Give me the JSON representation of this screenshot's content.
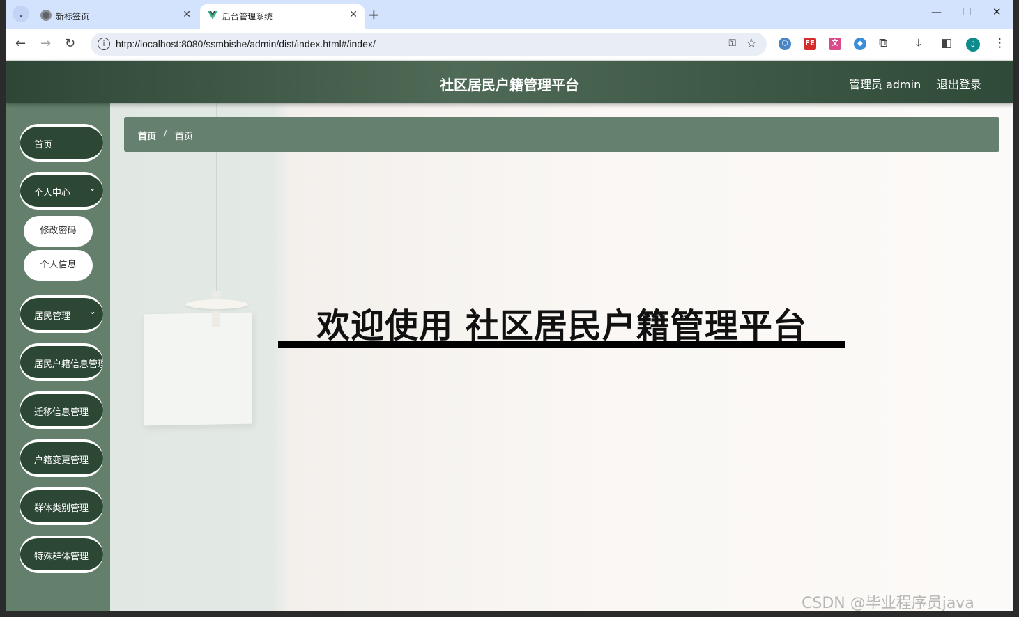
{
  "browser": {
    "tabs": [
      {
        "title": "新标签页",
        "active": false
      },
      {
        "title": "后台管理系统",
        "active": true
      }
    ],
    "url": "http://localhost:8080/ssmbishe/admin/dist/index.html#/index/",
    "profile_initial": "J"
  },
  "header": {
    "title": "社区居民户籍管理平台",
    "user_label": "管理员 admin",
    "logout_label": "退出登录"
  },
  "sidebar": {
    "items": [
      {
        "label": "首页"
      },
      {
        "label": "个人中心",
        "expandable": true,
        "children": [
          {
            "label": "修改密码"
          },
          {
            "label": "个人信息"
          }
        ]
      },
      {
        "label": "居民管理",
        "expandable": true
      },
      {
        "label": "居民户籍信息管理"
      },
      {
        "label": "迁移信息管理"
      },
      {
        "label": "户籍变更管理"
      },
      {
        "label": "群体类别管理"
      },
      {
        "label": "特殊群体管理"
      }
    ]
  },
  "breadcrumb": {
    "items": [
      "首页",
      "首页"
    ],
    "separator": "/"
  },
  "main": {
    "welcome_text": "欢迎使用 社区居民户籍管理平台"
  },
  "watermark": "CSDN @毕业程序员java",
  "colors": {
    "header": "#3f5a47",
    "sidebar": "#64806d",
    "pill": "#2d4735",
    "breadcrumb": "#66806f"
  }
}
